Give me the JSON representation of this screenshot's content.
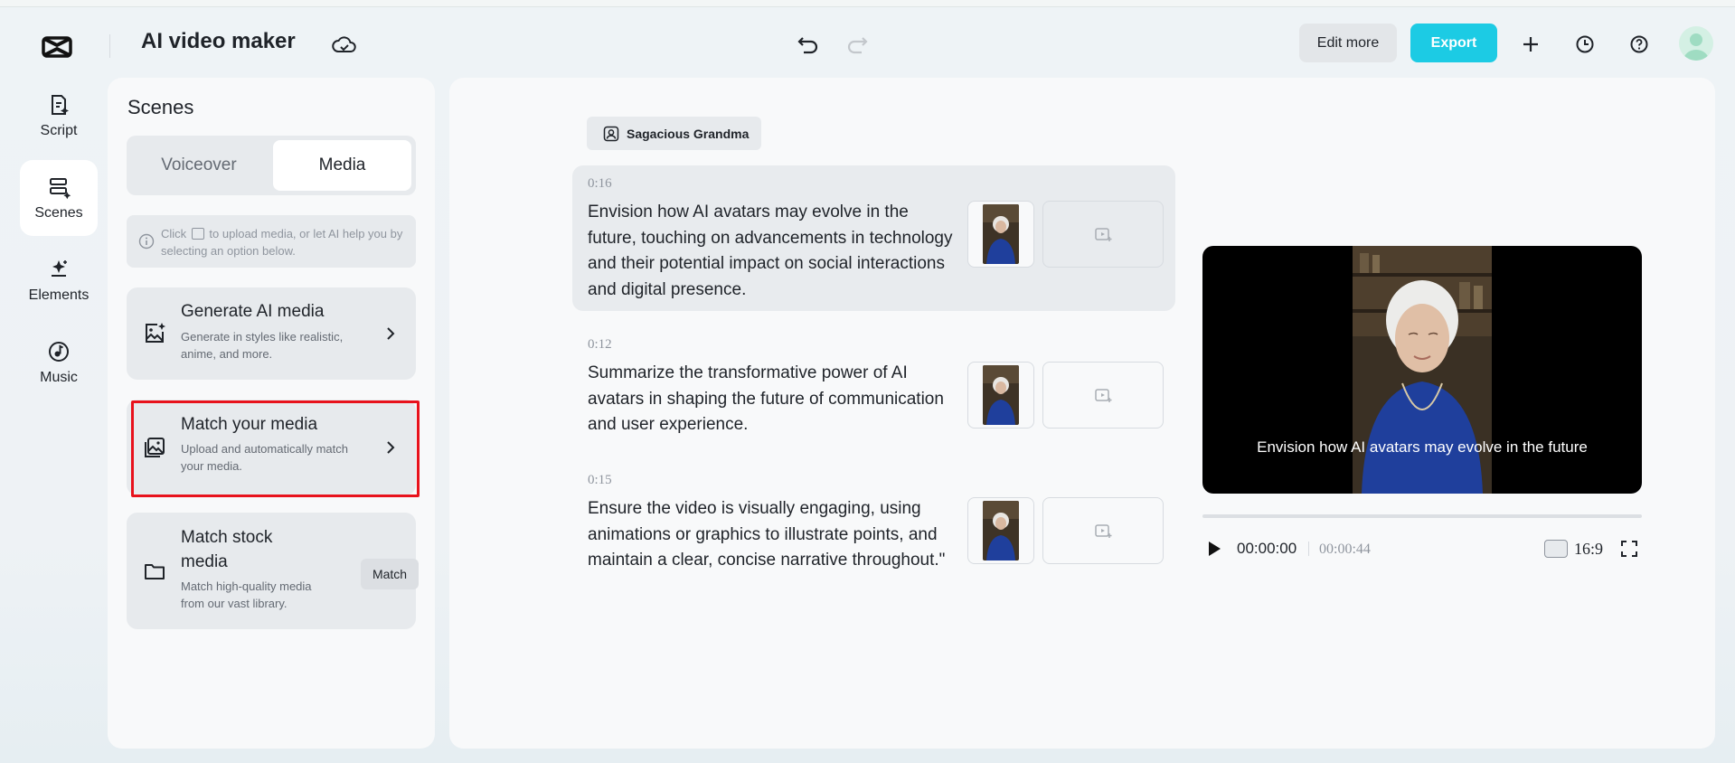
{
  "header": {
    "app_title": "AI video maker",
    "edit_more_label": "Edit more",
    "export_label": "Export",
    "accent_color": "#1ccbe4"
  },
  "rail": {
    "items": [
      {
        "label": "Script",
        "icon": "script-icon"
      },
      {
        "label": "Scenes",
        "icon": "scenes-icon",
        "active": true
      },
      {
        "label": "Elements",
        "icon": "elements-icon"
      },
      {
        "label": "Music",
        "icon": "music-icon"
      }
    ]
  },
  "scenes_panel": {
    "title": "Scenes",
    "tabs": [
      {
        "label": "Voiceover",
        "selected": false
      },
      {
        "label": "Media",
        "selected": true
      }
    ],
    "hint_before": "Click",
    "hint_after": "to upload media, or let AI help you by selecting an option below.",
    "options": [
      {
        "title": "Generate AI media",
        "desc": "Generate in styles like realistic, anime, and more."
      },
      {
        "title": "Match your media",
        "desc": "Upload and automatically match your media.",
        "highlighted": true
      },
      {
        "title": "Match stock media",
        "desc": "Match high-quality media from our vast library.",
        "button": "Match"
      }
    ]
  },
  "main": {
    "avatar_name": "Sagacious Grandma",
    "scenes": [
      {
        "time": "0:16",
        "text": "Envision how AI avatars may evolve in the future, touching on advancements in technology and their potential impact on social interactions and digital presence.",
        "selected": true
      },
      {
        "time": "0:12",
        "text": "Summarize the transformative power of AI avatars in shaping the future of communication and user experience.",
        "selected": false
      },
      {
        "time": "0:15",
        "text": "Ensure the video is visually engaging, using animations or graphics to illustrate points, and maintain a clear, concise narrative throughout.\"",
        "selected": false
      }
    ]
  },
  "preview": {
    "subtitle": "Envision how AI avatars may evolve in the future",
    "current_time": "00:00:00",
    "total_time": "00:00:44",
    "aspect_ratio": "16:9",
    "progress": 0
  }
}
